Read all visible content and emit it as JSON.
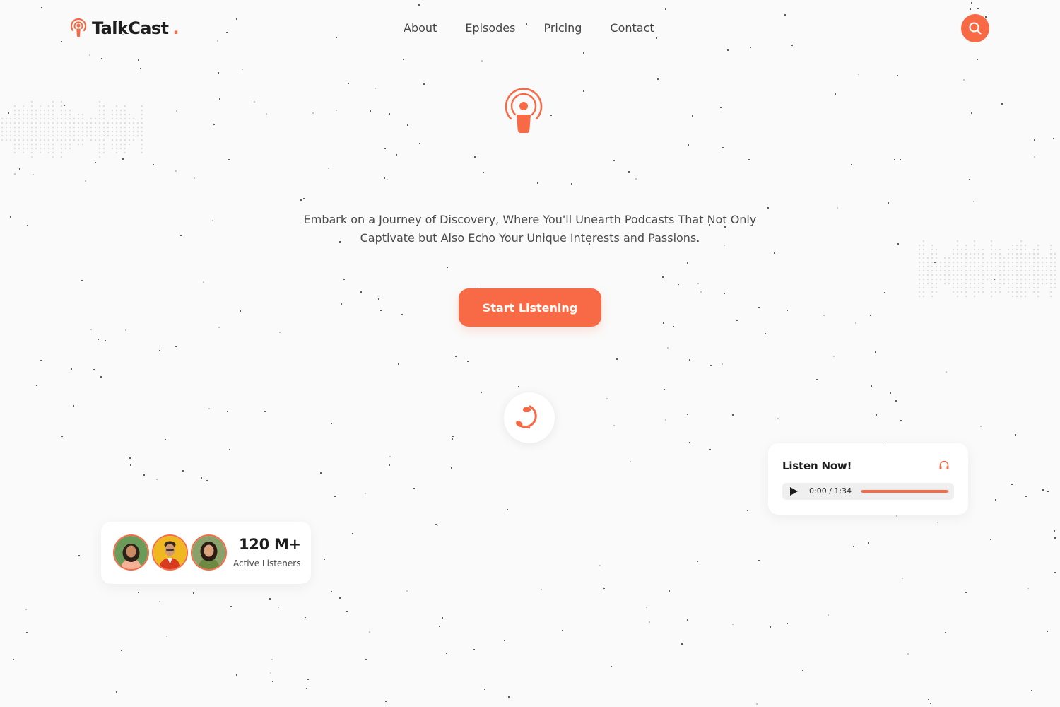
{
  "brand": {
    "name": "TalkCast",
    "dot": ".",
    "accent_color": "#f76a45",
    "logo_icon": "podcast-icon"
  },
  "nav": {
    "items": [
      {
        "label": "About"
      },
      {
        "label": "Episodes"
      },
      {
        "label": "Pricing"
      },
      {
        "label": "Contact"
      }
    ],
    "search_icon": "search-icon"
  },
  "hero": {
    "icon": "podcast-icon",
    "tagline": "Embark on a Journey of Discovery, Where You'll Unearth Podcasts That Not Only Captivate but Also Echo Your Unique Interests and Passions.",
    "cta_label": "Start Listening",
    "badge_icon": "headset-icon"
  },
  "listeners": {
    "count": "120 M+",
    "label": "Active Listeners",
    "avatars": [
      {
        "name": "listener-avatar-1",
        "bg": "#6a9b58",
        "shirt": "#f6b197"
      },
      {
        "name": "listener-avatar-2",
        "bg": "#f0b820",
        "shirt": "#d73a20"
      },
      {
        "name": "listener-avatar-3",
        "bg": "#8aa26a",
        "shirt": "#6e8a42"
      }
    ]
  },
  "player": {
    "title": "Listen Now!",
    "icon": "headphones-icon",
    "time": "0:00 / 1:34",
    "progress": 0.98
  }
}
